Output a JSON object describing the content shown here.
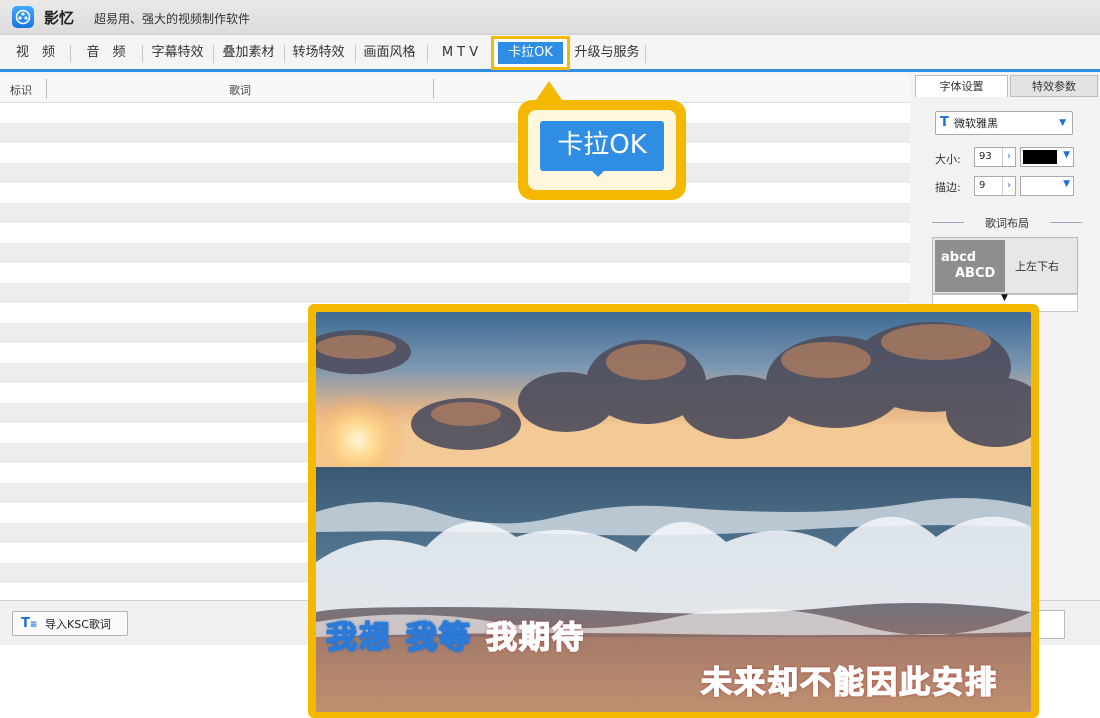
{
  "app": {
    "name": "影忆",
    "slogan": "超易用、强大的视频制作软件"
  },
  "tabs": [
    {
      "label": "视　频",
      "active": false
    },
    {
      "label": "音　频",
      "active": false
    },
    {
      "label": "字幕特效",
      "active": false
    },
    {
      "label": "叠加素材",
      "active": false
    },
    {
      "label": "转场特效",
      "active": false
    },
    {
      "label": "画面风格",
      "active": false
    },
    {
      "label": "M T V",
      "active": false
    },
    {
      "label": "卡拉OK",
      "active": true
    },
    {
      "label": "升级与服务",
      "active": false
    }
  ],
  "lyrics_table": {
    "columns": [
      "标识",
      "歌词"
    ],
    "rows": []
  },
  "callout": {
    "label": "卡拉OK"
  },
  "settings": {
    "tabs": [
      "字体设置",
      "特效参数"
    ],
    "font": "微软雅黑",
    "size_label": "大小:",
    "size_value": "93",
    "stroke_label": "描边:",
    "stroke_value": "9",
    "text_color": "#000000",
    "stroke_color": "#ffffff",
    "layout_title": "歌词布局",
    "layout_preview_top": "abcd",
    "layout_preview_bottom": "ABCD",
    "layout_option": "上左下右"
  },
  "bottom": {
    "import_button": "导入KSC歌词"
  },
  "preview": {
    "lyric_line1_words": [
      "我想",
      "我等",
      "我期待"
    ],
    "lyric_line2": "未来却不能因此安排",
    "colors": {
      "unsung_fill": "#ffffff",
      "unsung_outline": "#2b7ad8",
      "sung_fill": "#ff6a6a"
    }
  },
  "theme": {
    "accent": "#2f8de4",
    "highlight": "#f5b800"
  }
}
